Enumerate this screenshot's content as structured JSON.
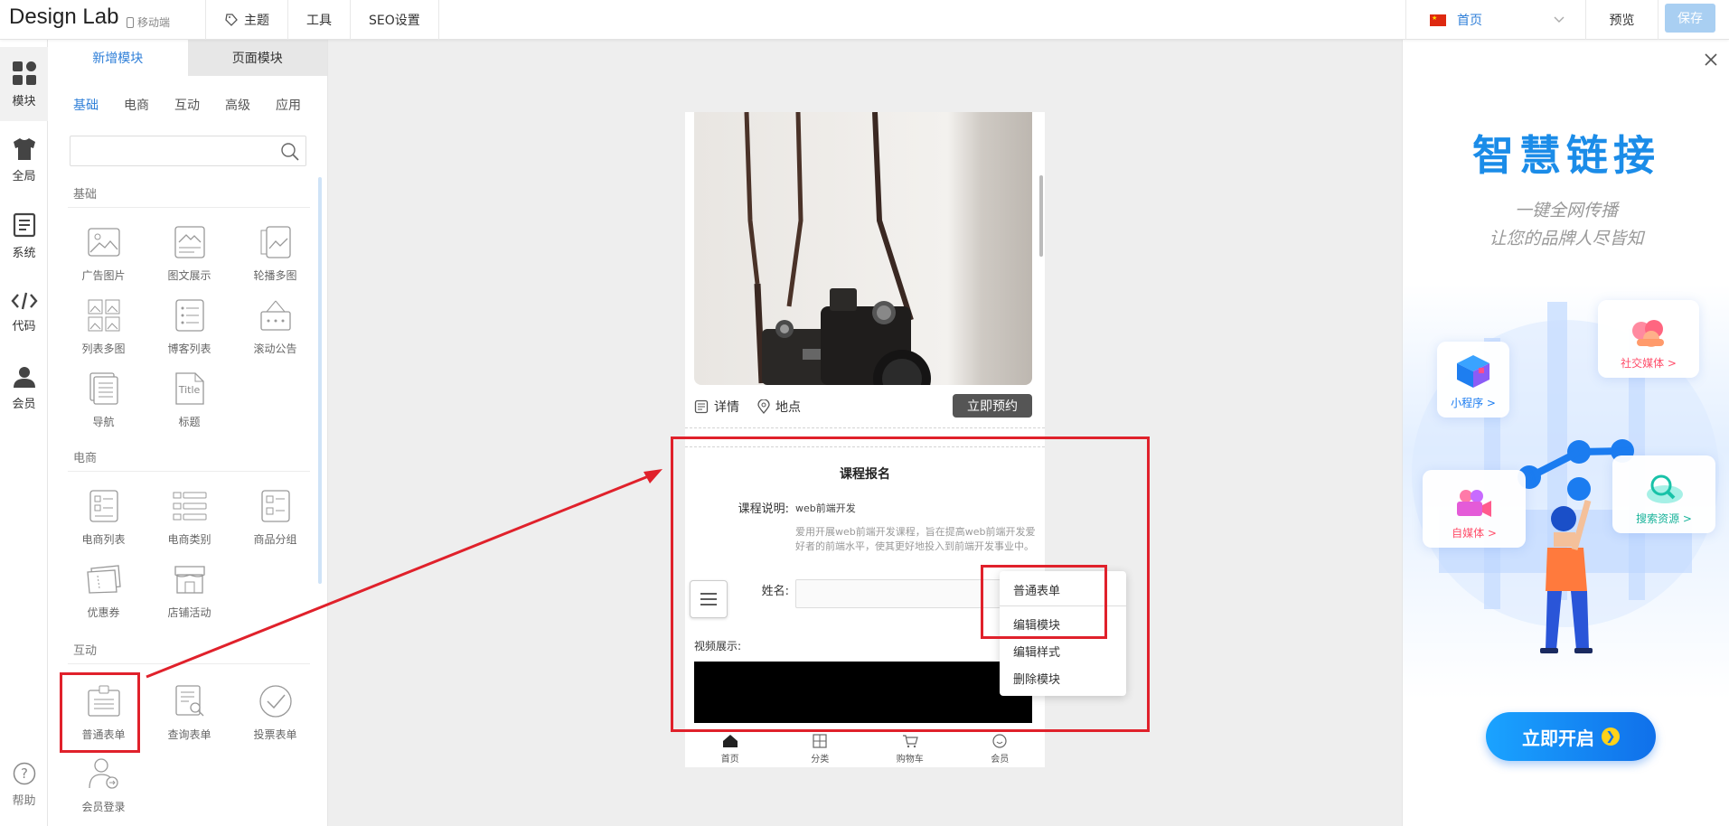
{
  "header": {
    "logo": "Design Lab",
    "mobile_tag": "移动端",
    "nav": [
      "主题",
      "工具",
      "SEO设置"
    ],
    "page_select": "首页",
    "preview": "预览",
    "save": "保存"
  },
  "rail": {
    "items": [
      {
        "label": "模块",
        "icon": "modules-icon"
      },
      {
        "label": "全局",
        "icon": "shirt-icon"
      },
      {
        "label": "系统",
        "icon": "document-icon"
      },
      {
        "label": "代码",
        "icon": "code-icon"
      },
      {
        "label": "会员",
        "icon": "user-icon"
      }
    ],
    "help": "帮助"
  },
  "panel": {
    "tabs": [
      "新增模块",
      "页面模块"
    ],
    "categories": [
      "基础",
      "电商",
      "互动",
      "高级",
      "应用"
    ],
    "search_placeholder": "",
    "sections": [
      {
        "title": "基础",
        "items": [
          "广告图片",
          "图文展示",
          "轮播多图",
          "列表多图",
          "博客列表",
          "滚动公告",
          "导航",
          "标题"
        ]
      },
      {
        "title": "电商",
        "items": [
          "电商列表",
          "电商类别",
          "商品分组",
          "优惠券",
          "店铺活动"
        ]
      },
      {
        "title": "互动",
        "items": [
          "普通表单",
          "查询表单",
          "投票表单",
          "会员登录"
        ]
      }
    ],
    "title_icon_text": "Title"
  },
  "canvas": {
    "detail": "详情",
    "location": "地点",
    "book_button": "立即预约",
    "form_title": "课程报名",
    "course_label": "课程说明:",
    "course_value": "web前端开发",
    "course_desc": "爱用开展web前端开发课程，旨在提高web前端开发爱好者的前端水平，使其更好地投入到前端开发事业中。",
    "name_label": "姓名:",
    "video_label": "视频展示:",
    "bottom_nav": [
      "首页",
      "分类",
      "购物车",
      "会员"
    ]
  },
  "context_menu": {
    "items": [
      "普通表单",
      "编辑模块",
      "编辑样式",
      "删除模块"
    ]
  },
  "ad": {
    "title": "智慧链接",
    "subtitle1": "一键全网传播",
    "subtitle2": "让您的品牌人尽皆知",
    "cards": [
      "小程序 >",
      "社交媒体 >",
      "自媒体 >",
      "搜索资源 >"
    ],
    "button": "立即开启"
  },
  "colors": {
    "accent": "#2f7fd8",
    "highlight_red": "#e0212b",
    "save_disabled": "#a9cff2",
    "ad_blue": "#1b8ce8"
  }
}
